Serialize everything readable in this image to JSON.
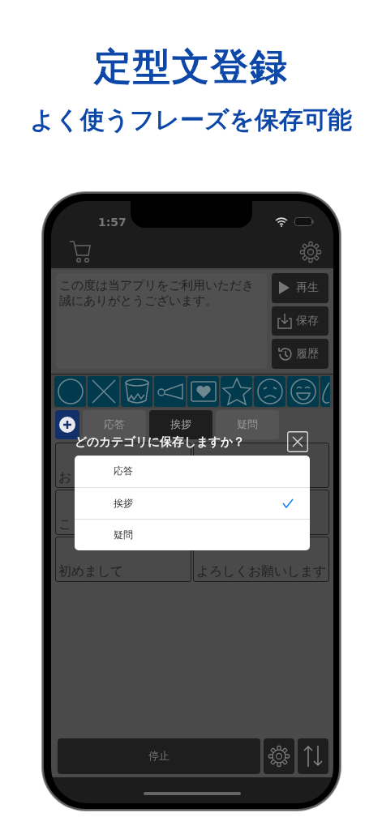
{
  "headline": {
    "title": "定型文登録",
    "subtitle": "よく使うフレーズを保存可能"
  },
  "status_bar": {
    "time": "1:57"
  },
  "text_input": {
    "value": "この度は当アプリをご利用いただき誠にありがとうございます。"
  },
  "side_buttons": [
    {
      "kind": "play",
      "label": "再生"
    },
    {
      "kind": "save",
      "label": "保存"
    },
    {
      "kind": "history",
      "label": "履歴"
    }
  ],
  "category_tabs": [
    {
      "label": "応答",
      "selected": false
    },
    {
      "label": "挨拶",
      "selected": true
    },
    {
      "label": "疑問",
      "selected": false
    }
  ],
  "phrases": [
    {
      "kind": "text",
      "text": "お"
    },
    {
      "kind": "blank"
    },
    {
      "kind": "text",
      "text": "こ"
    },
    {
      "kind": "blank"
    },
    {
      "kind": "text",
      "text": "初めまして"
    },
    {
      "kind": "text",
      "text": "よろしくお願いします"
    }
  ],
  "dialog": {
    "title": "どのカテゴリに保存しますか？",
    "options": [
      {
        "label": "応答",
        "selected": false
      },
      {
        "label": "挨拶",
        "selected": true
      },
      {
        "label": "疑問",
        "selected": false
      }
    ]
  },
  "bottom_bar": {
    "stop_label": "停止"
  }
}
